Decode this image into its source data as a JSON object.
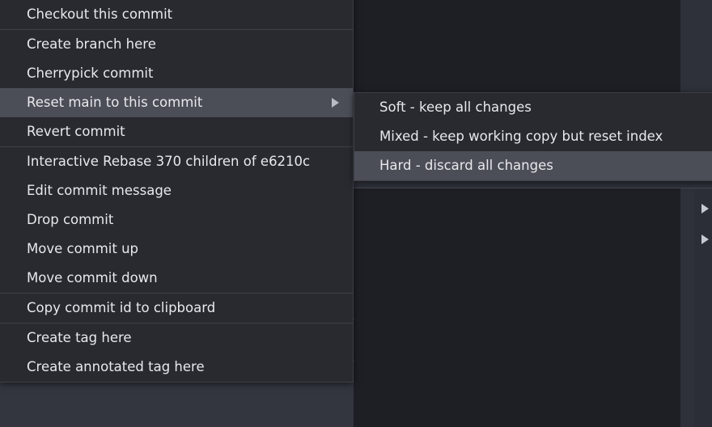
{
  "app": {
    "theme": "dark",
    "colors": {
      "menu_background": "#282a30",
      "menu_border": "#3b3e46",
      "menu_text": "#e8e9ec",
      "highlight_background": "#4b4e57",
      "separator": "#3d4049",
      "window_background": "#33363f",
      "panel_background": "#1d1f25",
      "arrow": "#b9bcc4"
    }
  },
  "context_menu": {
    "name": "commit-context-menu",
    "groups": [
      {
        "items": [
          {
            "label": "Checkout this commit",
            "name": "checkout-this-commit",
            "has_submenu": false,
            "highlighted": false
          }
        ]
      },
      {
        "items": [
          {
            "label": "Create branch here",
            "name": "create-branch-here",
            "has_submenu": false,
            "highlighted": false
          },
          {
            "label": "Cherrypick commit",
            "name": "cherrypick-commit",
            "has_submenu": false,
            "highlighted": false
          },
          {
            "label": "Reset main to this commit",
            "name": "reset-main-to-this-commit",
            "has_submenu": true,
            "highlighted": true
          },
          {
            "label": "Revert commit",
            "name": "revert-commit",
            "has_submenu": false,
            "highlighted": false
          }
        ]
      },
      {
        "items": [
          {
            "label": "Interactive Rebase 370 children of e6210c",
            "name": "interactive-rebase",
            "has_submenu": false,
            "highlighted": false
          },
          {
            "label": "Edit commit message",
            "name": "edit-commit-message",
            "has_submenu": false,
            "highlighted": false
          },
          {
            "label": "Drop commit",
            "name": "drop-commit",
            "has_submenu": false,
            "highlighted": false
          },
          {
            "label": "Move commit up",
            "name": "move-commit-up",
            "has_submenu": false,
            "highlighted": false
          },
          {
            "label": "Move commit down",
            "name": "move-commit-down",
            "has_submenu": false,
            "highlighted": false
          }
        ]
      },
      {
        "items": [
          {
            "label": "Copy commit id to clipboard",
            "name": "copy-commit-id-to-clipboard",
            "has_submenu": false,
            "highlighted": false
          }
        ]
      },
      {
        "items": [
          {
            "label": "Create tag here",
            "name": "create-tag-here",
            "has_submenu": false,
            "highlighted": false
          },
          {
            "label": "Create annotated tag here",
            "name": "create-annotated-tag-here",
            "has_submenu": false,
            "highlighted": false
          }
        ]
      }
    ]
  },
  "reset_submenu": {
    "name": "reset-submenu",
    "items": [
      {
        "label": "Soft - keep all changes",
        "name": "reset-soft",
        "highlighted": false
      },
      {
        "label": "Mixed - keep working copy but reset index",
        "name": "reset-mixed",
        "highlighted": false
      },
      {
        "label": "Hard - discard all changes",
        "name": "reset-hard",
        "highlighted": true
      }
    ]
  },
  "background": {
    "edge_arrows": [
      {
        "name": "background-submenu-arrow-1"
      },
      {
        "name": "background-submenu-arrow-2"
      }
    ]
  }
}
